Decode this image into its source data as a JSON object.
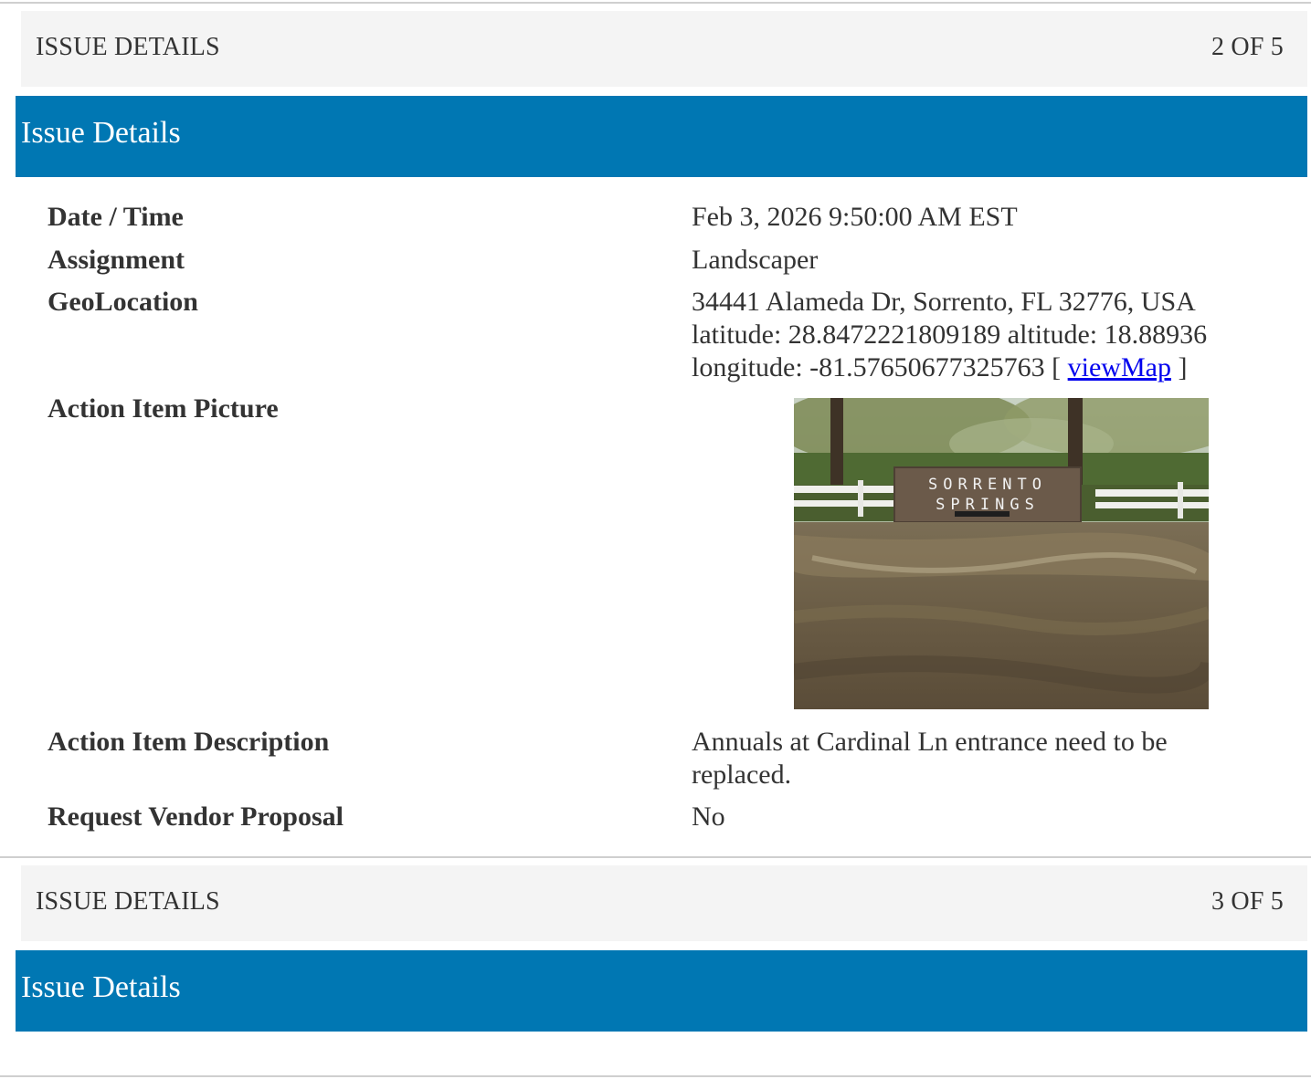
{
  "section1": {
    "header_label": "ISSUE DETAILS",
    "counter": "2 OF 5",
    "band_title": "Issue Details",
    "fields": {
      "date_label": "Date / Time",
      "date_value": "Feb 3, 2026 9:50:00 AM EST",
      "assignment_label": "Assignment",
      "assignment_value": "Landscaper",
      "geo_label": "GeoLocation",
      "geo_address": "34441 Alameda Dr, Sorrento, FL 32776, USA",
      "geo_lat_alt": "latitude: 28.8472221809189 altitude: 18.88936",
      "geo_lon_prefix": "longitude: -81.57650677325763 [ ",
      "geo_map_link": "viewMap",
      "geo_lon_suffix": " ]",
      "picture_label": "Action Item Picture",
      "picture_sign_line1": "SORRENTO",
      "picture_sign_line2": "SPRINGS",
      "description_label": "Action Item Description",
      "description_line1": "Annuals at Cardinal Ln entrance need to be",
      "description_line2": "replaced.",
      "vendor_label": "Request Vendor Proposal",
      "vendor_value": "No"
    }
  },
  "section2": {
    "header_label": "ISSUE DETAILS",
    "counter": "3 OF 5",
    "band_title": "Issue Details"
  },
  "colors": {
    "band": "#0077b3",
    "header_bar": "#f4f4f4",
    "link": "#0000ee"
  }
}
